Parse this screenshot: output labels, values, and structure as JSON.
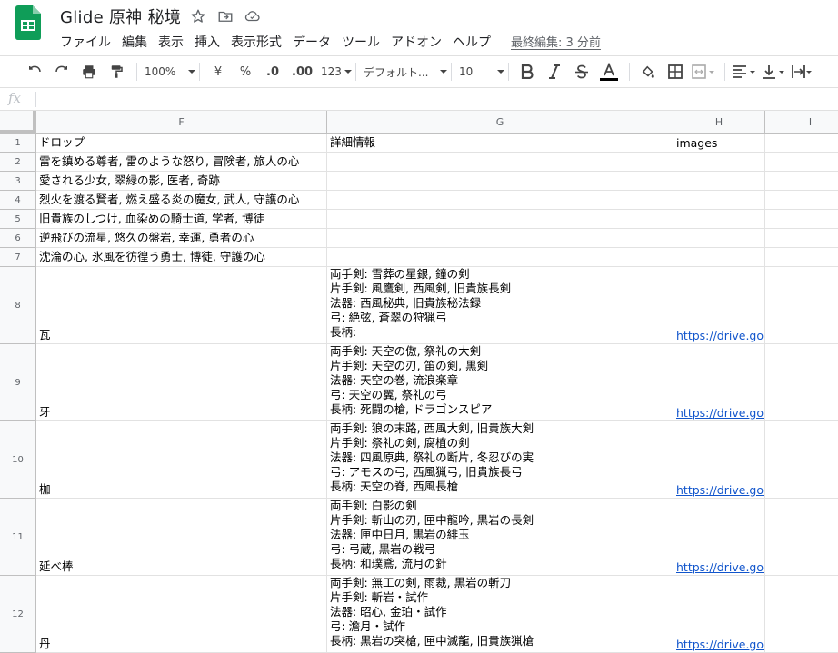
{
  "doc": {
    "title": "Glide 原神 秘境",
    "last_edit": "最終編集: 3 分前"
  },
  "menu": [
    "ファイル",
    "編集",
    "表示",
    "挿入",
    "表示形式",
    "データ",
    "ツール",
    "アドオン",
    "ヘルプ"
  ],
  "toolbar": {
    "zoom": "100%",
    "currency": "¥",
    "percent": "%",
    "dec_decrease": ".0",
    "dec_increase": ".00",
    "more_formats": "123",
    "font": "デフォルト...",
    "font_size": "10",
    "text_color_accent": "#000000"
  },
  "formula_bar": {
    "fx": "fx",
    "value": ""
  },
  "columns": [
    "F",
    "G",
    "H",
    "I"
  ],
  "rows": [
    {
      "num": "1",
      "F": "ドロップ",
      "G": "詳細情報",
      "H": "images"
    },
    {
      "num": "2",
      "F": "雷を鎮める尊者, 雷のような怒り, 冒険者, 旅人の心",
      "G": "",
      "H": ""
    },
    {
      "num": "3",
      "F": "愛される少女, 翠緑の影, 医者, 奇跡",
      "G": "",
      "H": ""
    },
    {
      "num": "4",
      "F": "烈火を渡る賢者, 燃え盛る炎の魔女, 武人, 守護の心",
      "G": "",
      "H": ""
    },
    {
      "num": "5",
      "F": "旧貴族のしつけ, 血染めの騎士道, 学者, 博徒",
      "G": "",
      "H": ""
    },
    {
      "num": "6",
      "F": "逆飛びの流星, 悠久の盤岩, 幸運, 勇者の心",
      "G": "",
      "H": ""
    },
    {
      "num": "7",
      "F": "沈淪の心, 氷風を彷徨う勇士, 博徒, 守護の心",
      "G": "",
      "H": ""
    },
    {
      "num": "8",
      "F": "瓦",
      "G": [
        "両手剣: 雪葬の星銀, 鐘の剣",
        "片手剣: 風鷹剣, 西風剣, 旧貴族長剣",
        "法器: 西風秘典, 旧貴族秘法録",
        "弓: 絶弦, 蒼翠の狩猟弓",
        "長柄:"
      ],
      "H": "https://drive.google.com/file/d/"
    },
    {
      "num": "9",
      "F": "牙",
      "G": [
        "両手剣: 天空の傲, 祭礼の大剣",
        "片手剣: 天空の刃, 笛の剣, 黒剣",
        "法器: 天空の巻, 流浪楽章",
        "弓: 天空の翼, 祭礼の弓",
        "長柄: 死闘の槍, ドラゴンスピア"
      ],
      "H": "https://drive.google.com/file/d/"
    },
    {
      "num": "10",
      "F": "枷",
      "G": [
        "両手剣: 狼の末路, 西風大剣, 旧貴族大剣",
        "片手剣: 祭礼の剣, 腐植の剣",
        "法器: 四風原典, 祭礼の断片, 冬忍びの実",
        "弓: アモスの弓, 西風猟弓, 旧貴族長弓",
        "長柄: 天空の脊, 西風長槍"
      ],
      "H": "https://drive.google.com/file/d/"
    },
    {
      "num": "11",
      "F": "延べ棒",
      "G": [
        "両手剣: 白影の剣",
        "片手剣: 斬山の刃, 匣中龍吟, 黒岩の長剣",
        "法器: 匣中日月, 黒岩の緋玉",
        "弓: 弓蔵, 黒岩の戦弓",
        "長柄: 和璞鳶, 流月の針"
      ],
      "H": "https://drive.google.com/file/d/"
    },
    {
      "num": "12",
      "F": "丹",
      "G": [
        "両手剣: 無工の剣, 雨裁, 黒岩の斬刀",
        "片手剣: 斬岩・試作",
        "法器: 昭心, 金珀・試作",
        "弓: 澹月・試作",
        "長柄: 黒岩の突槍, 匣中滅龍, 旧貴族猟槍"
      ],
      "H": "https://drive.google.com/file/d/"
    }
  ]
}
